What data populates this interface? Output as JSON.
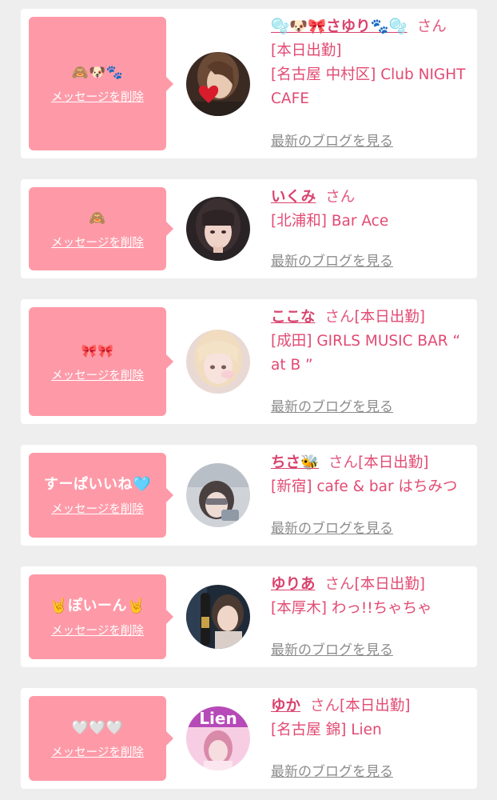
{
  "common": {
    "delete_label": "メッセージを削除",
    "blog_label": "最新のブログを見る",
    "honorific": "さん"
  },
  "cards": [
    {
      "bubble_message": "🙈🐶🐾",
      "name": "🫧🐶🎀さゆり🐾🫧",
      "shift": "[本日出勤]",
      "shop": "[名古屋 中村区] Club NIGHT CAFE"
    },
    {
      "bubble_message": "🙈",
      "name": "いくみ",
      "shift": "",
      "shop": "[北浦和] Bar Ace"
    },
    {
      "bubble_message": "🎀🎀",
      "name": "ここな",
      "shift": "[本日出勤]",
      "shop": "[成田] GIRLS MUSIC BAR “ at B ”"
    },
    {
      "bubble_message": "すーぱいいね🩵",
      "name": "ちさ🐝",
      "shift": "[本日出勤]",
      "shop": "[新宿] cafe & bar はちみつ"
    },
    {
      "bubble_message": "🤘ぽいーん🤘",
      "name": "ゆりあ",
      "shift": "[本日出勤]",
      "shop": "[本厚木] わっ!!ちゃちゃ"
    },
    {
      "bubble_message": "🤍🤍🤍",
      "name": "ゆか",
      "shift": "[本日出勤]",
      "shop": "[名古屋 錦] Lien"
    }
  ],
  "colors": {
    "bubble": "#fe9aa8",
    "name_pink": "#d8436d",
    "link_gray": "#8c8c8c",
    "background": "#eeeeee"
  }
}
